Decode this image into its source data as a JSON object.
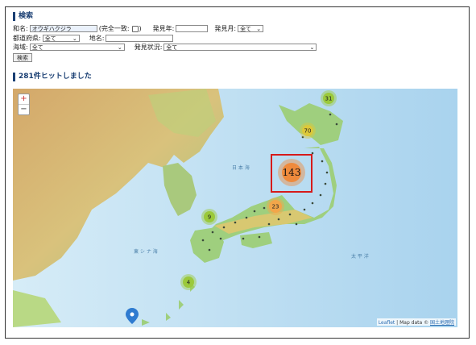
{
  "search": {
    "title": "検索",
    "name_label": "和名:",
    "name_value": "オウギハクジラ",
    "exact_match_label_open": "(完全一致:",
    "exact_match_label_close": ")",
    "year_label": "発見年:",
    "year_value": "",
    "month_label": "発見月:",
    "month_value": "全て",
    "prefecture_label": "都道府県:",
    "prefecture_value": "全て",
    "place_label": "地名:",
    "place_value": "",
    "sea_label": "海域:",
    "sea_value": "全て",
    "status_label": "発見状況:",
    "status_value": "全て",
    "search_button": "検索"
  },
  "results": {
    "title": "281件ヒットしました"
  },
  "map": {
    "zoom_in": "+",
    "zoom_out": "−",
    "clusters": [
      {
        "label": "31",
        "color": "#9bc93b"
      },
      {
        "label": "70",
        "color": "#dcc83a"
      },
      {
        "label": "143",
        "color": "#ef8a3c"
      },
      {
        "label": "23",
        "color": "#f2a64a"
      },
      {
        "label": "9",
        "color": "#9bc93b"
      },
      {
        "label": "4",
        "color": "#9bc93b"
      }
    ],
    "sea_labels": {
      "japan_sea": "日 本 海",
      "east_china_sea": "東 シ ナ 海",
      "pacific": "太 平 洋"
    },
    "attribution_leaflet": "Leaflet",
    "attribution_sep": " | Map data © ",
    "attribution_gsi": "国土地理院",
    "marker_icon": "map-pin-icon",
    "highlight_color": "#d61a1a"
  }
}
